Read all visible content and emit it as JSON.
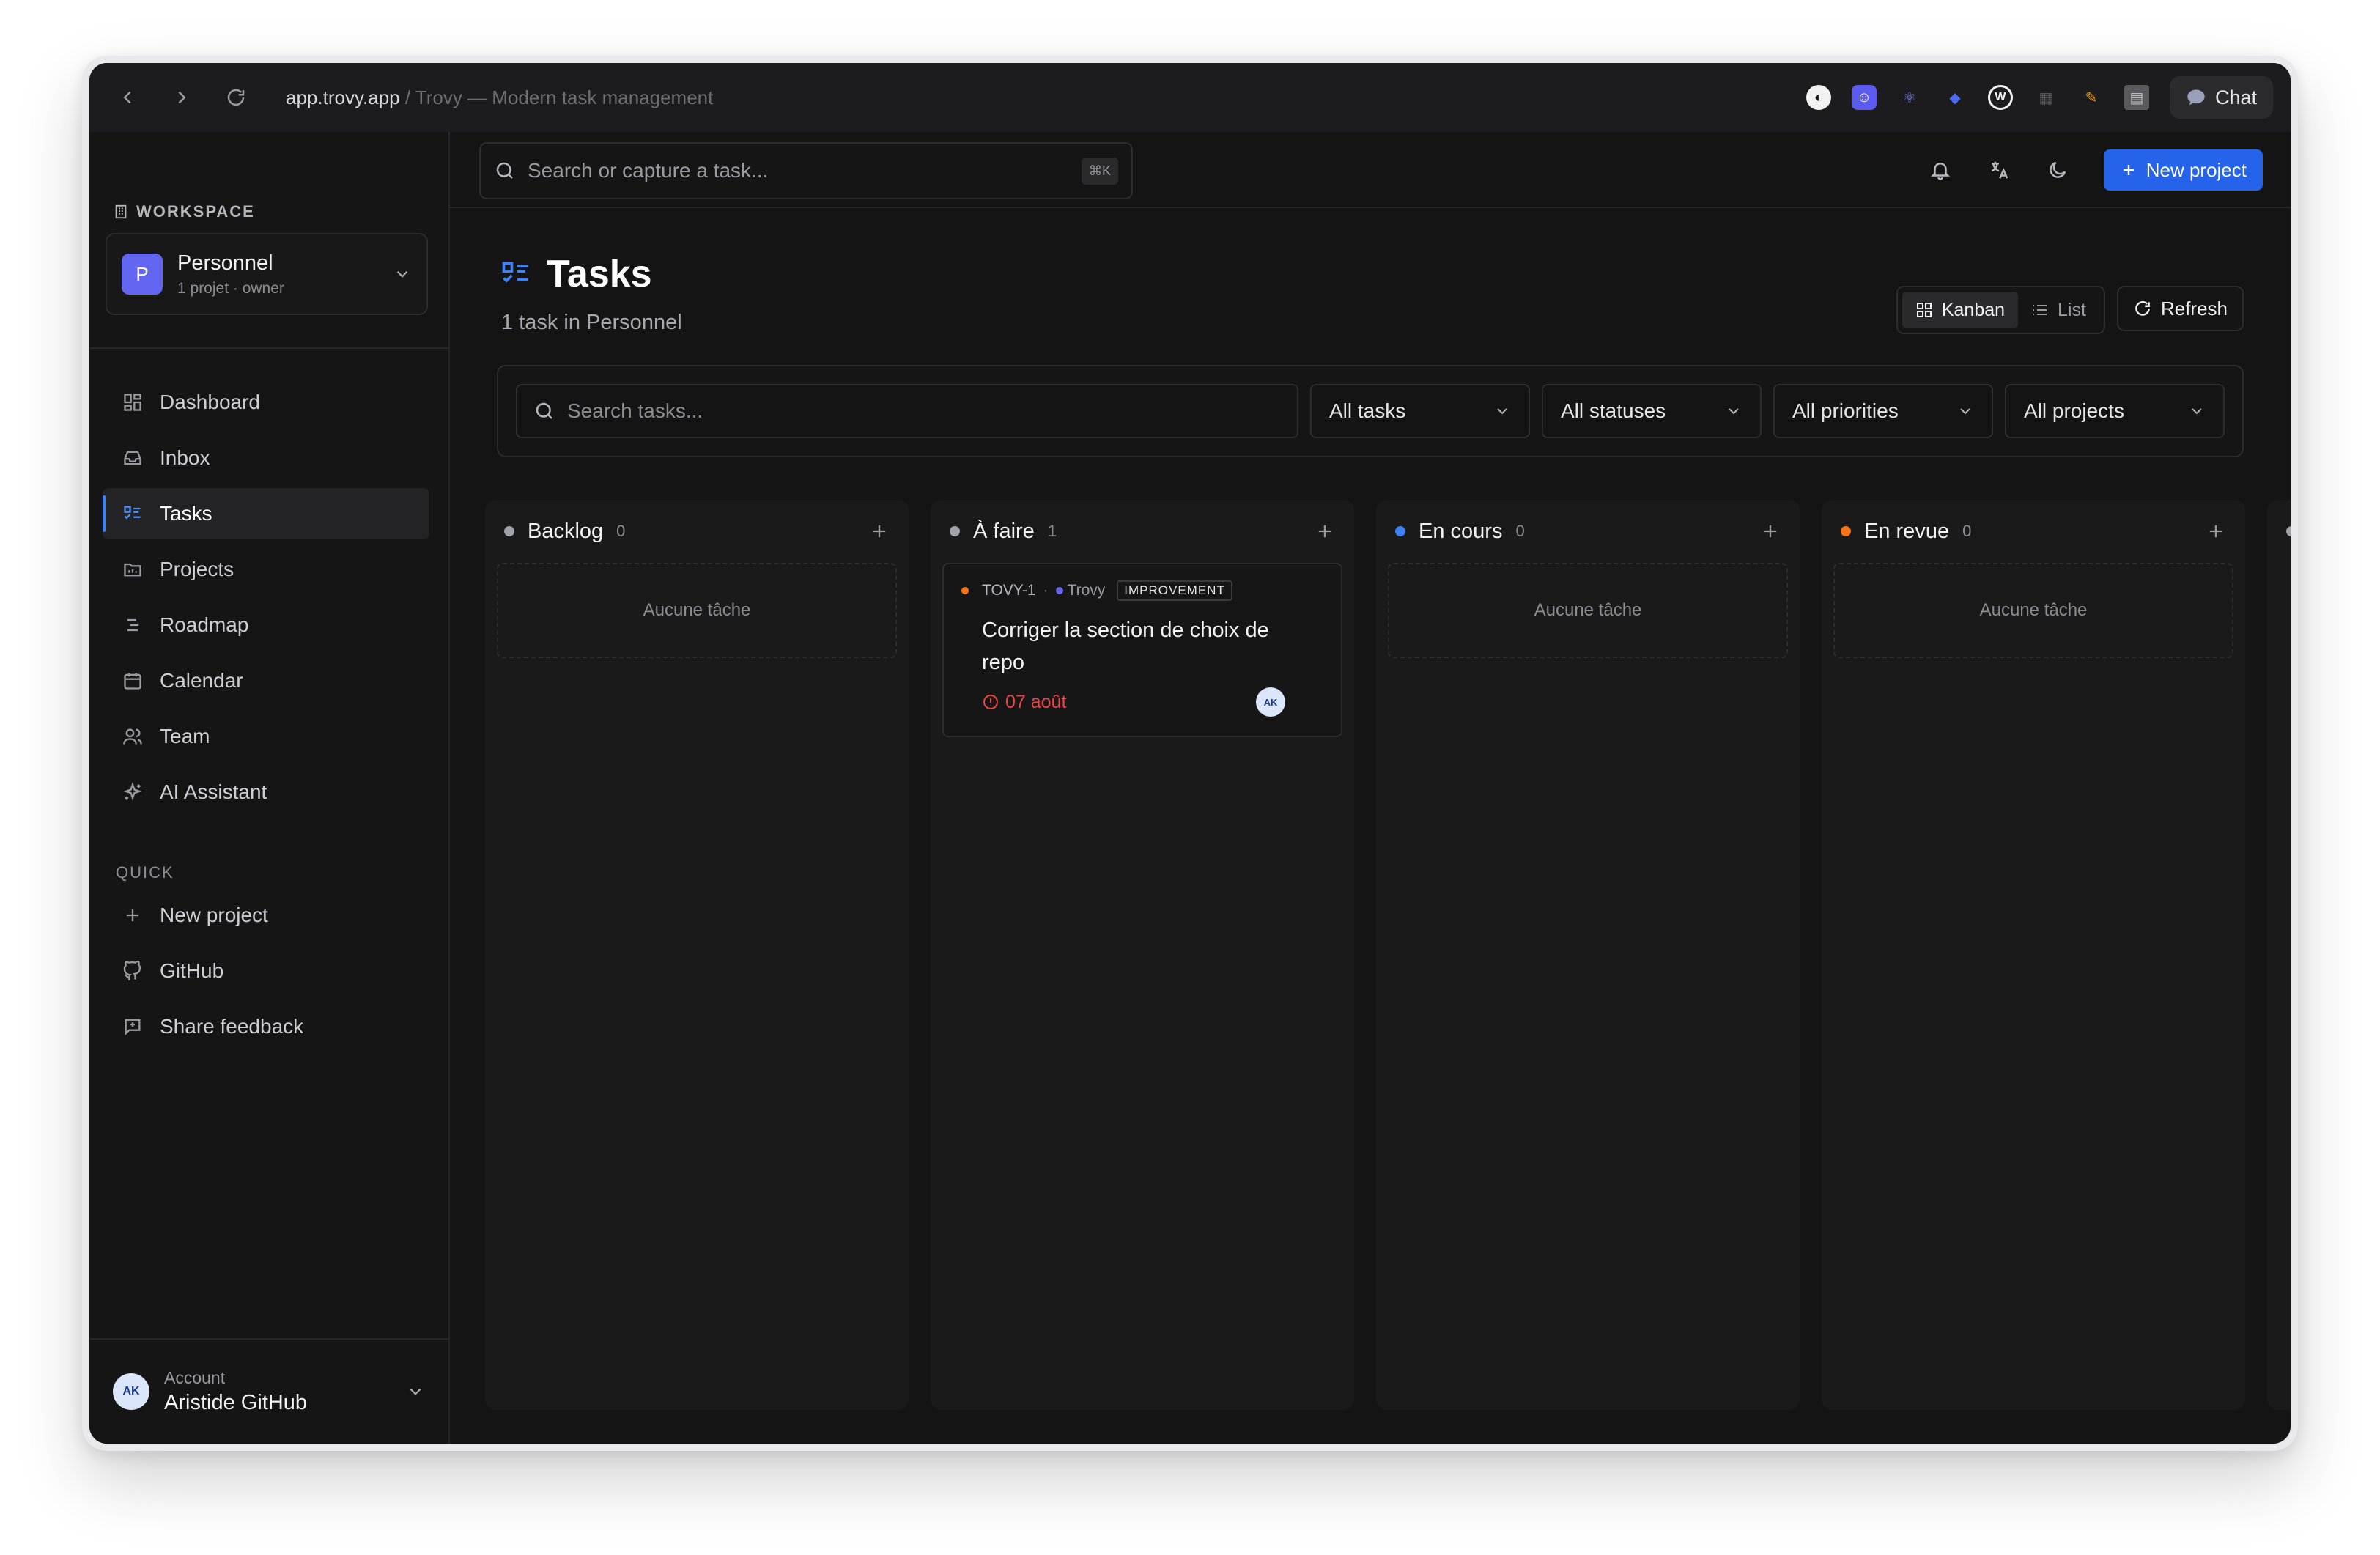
{
  "browser": {
    "url_host": "app.trovy.app",
    "url_sep": " / ",
    "url_title": "Trovy — Modern task management",
    "chat_label": "Chat"
  },
  "sidebar": {
    "workspace_label": "WORKSPACE",
    "workspace": {
      "initial": "P",
      "name": "Personnel",
      "meta": "1 projet · owner"
    },
    "items": [
      {
        "label": "Dashboard",
        "icon": "dashboard-icon"
      },
      {
        "label": "Inbox",
        "icon": "inbox-icon"
      },
      {
        "label": "Tasks",
        "icon": "tasks-icon"
      },
      {
        "label": "Projects",
        "icon": "folder-icon"
      },
      {
        "label": "Roadmap",
        "icon": "roadmap-icon"
      },
      {
        "label": "Calendar",
        "icon": "calendar-icon"
      },
      {
        "label": "Team",
        "icon": "team-icon"
      },
      {
        "label": "AI Assistant",
        "icon": "sparkles-icon"
      }
    ],
    "active_item": "Tasks",
    "quick_label": "QUICK",
    "quick": [
      {
        "label": "New project",
        "icon": "plus-icon"
      },
      {
        "label": "GitHub",
        "icon": "github-icon"
      },
      {
        "label": "Share feedback",
        "icon": "feedback-icon"
      }
    ],
    "account": {
      "initials": "AK",
      "label": "Account",
      "name": "Aristide GitHub"
    }
  },
  "topbar": {
    "search_placeholder": "Search or capture a task...",
    "shortcut": "⌘K",
    "new_project_label": "New project"
  },
  "page": {
    "title": "Tasks",
    "subtitle": "1 task in Personnel",
    "view_kanban": "Kanban",
    "view_list": "List",
    "refresh": "Refresh"
  },
  "filters": {
    "search_placeholder": "Search tasks...",
    "tasks": "All tasks",
    "statuses": "All statuses",
    "priorities": "All priorities",
    "projects": "All projects"
  },
  "colors": {
    "accent": "#2563eb",
    "backlog": "#a1a1aa",
    "todo": "#a1a1aa",
    "in_progress": "#3b82f6",
    "review": "#f97316",
    "overdue": "#ef4444"
  },
  "columns": [
    {
      "name": "Backlog",
      "count": "0",
      "empty_text": "Aucune tâche"
    },
    {
      "name": "À faire",
      "count": "1",
      "empty_text": ""
    },
    {
      "name": "En cours",
      "count": "0",
      "empty_text": "Aucune tâche"
    },
    {
      "name": "En revue",
      "count": "0",
      "empty_text": "Aucune tâche"
    }
  ],
  "card": {
    "id": "TOVY-1",
    "sep": "·",
    "project": "Trovy",
    "tag": "IMPROVEMENT",
    "title": "Corriger la section de choix de repo",
    "due": "07 août",
    "assignee": "AK"
  }
}
